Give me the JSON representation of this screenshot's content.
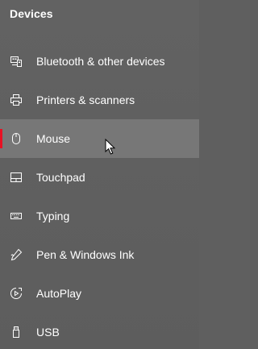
{
  "section": {
    "title": "Devices"
  },
  "nav": {
    "items": [
      {
        "label": "Bluetooth & other devices",
        "icon": "bluetooth-devices-icon",
        "active": false
      },
      {
        "label": "Printers & scanners",
        "icon": "printer-icon",
        "active": false
      },
      {
        "label": "Mouse",
        "icon": "mouse-icon",
        "active": true
      },
      {
        "label": "Touchpad",
        "icon": "touchpad-icon",
        "active": false
      },
      {
        "label": "Typing",
        "icon": "keyboard-icon",
        "active": false
      },
      {
        "label": "Pen & Windows Ink",
        "icon": "pen-icon",
        "active": false
      },
      {
        "label": "AutoPlay",
        "icon": "autoplay-icon",
        "active": false
      },
      {
        "label": "USB",
        "icon": "usb-icon",
        "active": false
      }
    ]
  },
  "colors": {
    "background": "#5f5f5f",
    "active_background": "#777777",
    "accent": "#e81123",
    "text": "#ffffff"
  }
}
